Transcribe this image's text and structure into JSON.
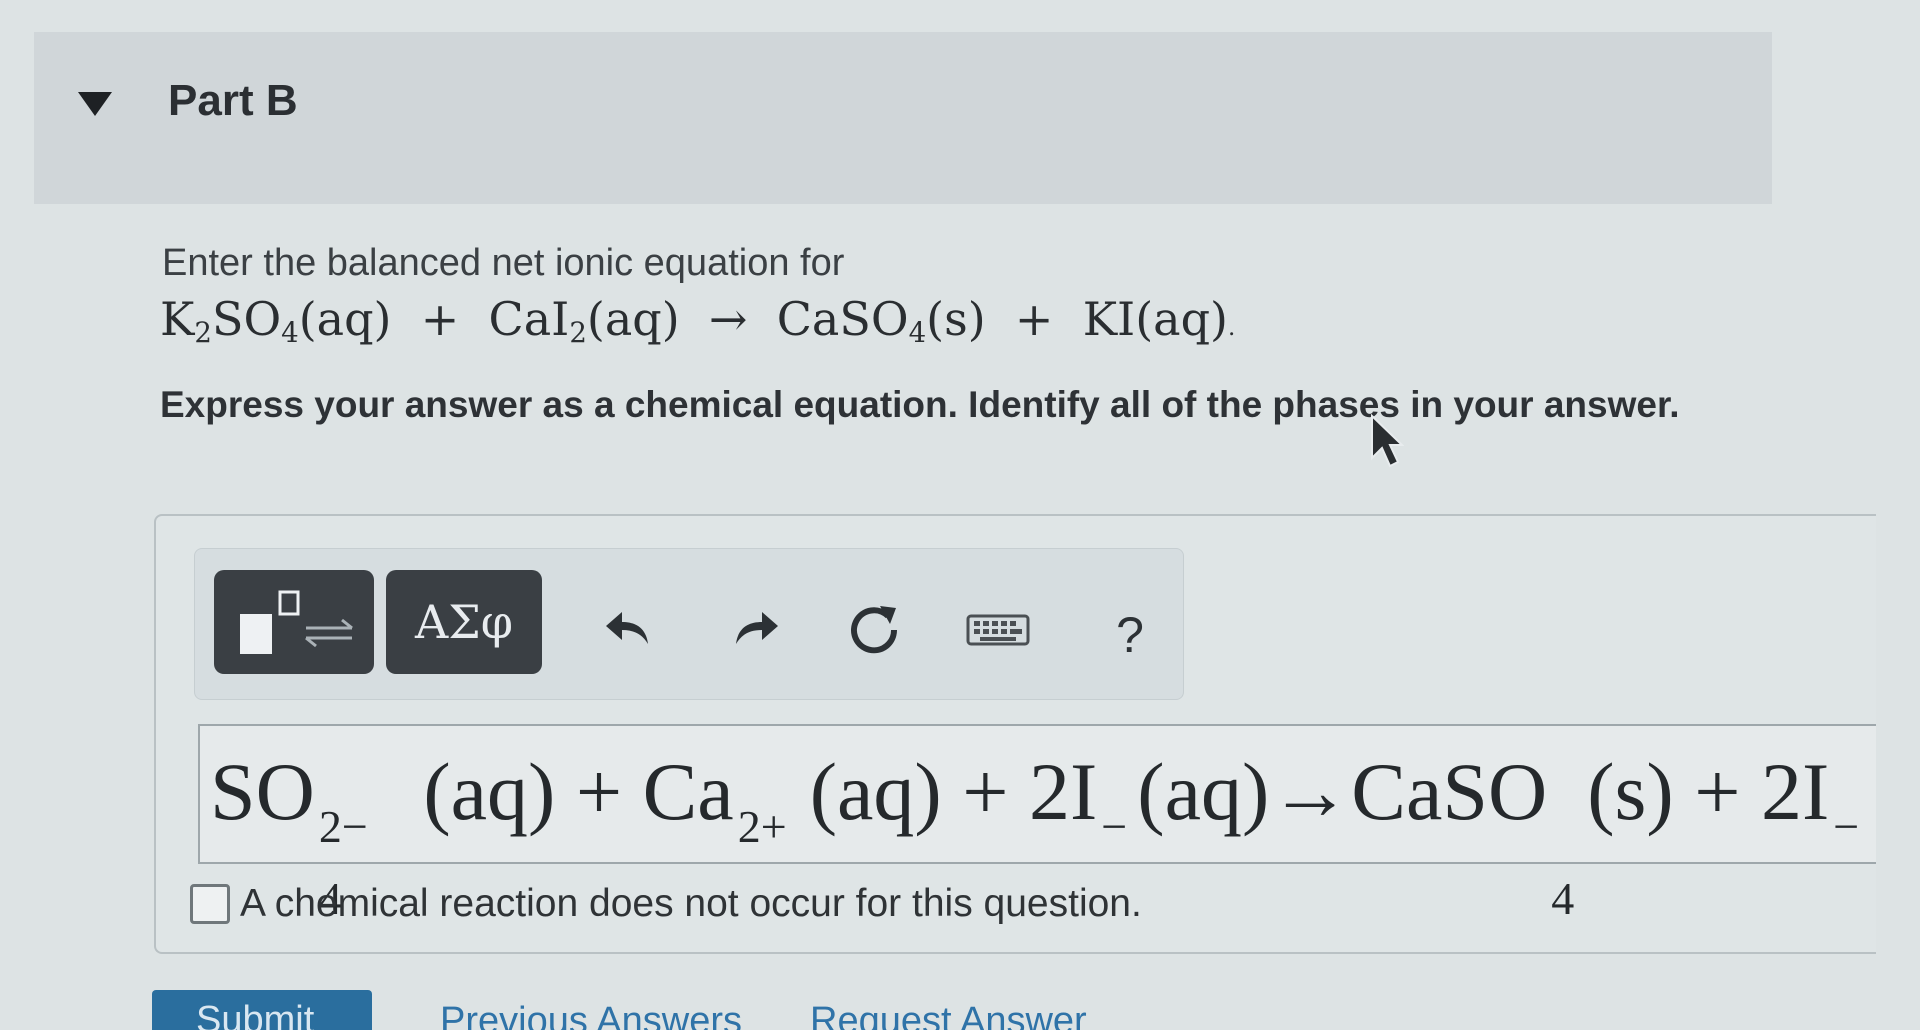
{
  "part": {
    "title": "Part B"
  },
  "question": {
    "prompt": "Enter the balanced net ionic equation for",
    "equation": {
      "r1": "K",
      "r1_sub": "2",
      "r1_mid": "SO",
      "r1_sub2": "4",
      "r1_phase": "(aq)",
      "plus": "+",
      "r2": "CaI",
      "r2_sub": "2",
      "r2_phase": "(aq)",
      "arrow": "→",
      "p1": "CaSO",
      "p1_sub": "4",
      "p1_phase": "(s)",
      "p2": "KI(aq)",
      "end": "."
    },
    "instructions": "Express your answer as a chemical equation. Identify all of the phases in your answer."
  },
  "toolbar": {
    "symbols_label": "ΑΣφ",
    "help_label": "?",
    "icons": [
      "templates-icon",
      "undo-icon",
      "redo-icon",
      "reset-icon",
      "keyboard-icon",
      "help-icon"
    ]
  },
  "answer": {
    "t1": "SO",
    "t1_sub": "4",
    "t1_sup": "2−",
    "t1_phase": "(aq)",
    "plus1": "+",
    "t2": "Ca",
    "t2_sup": "2+",
    "t2_phase": "(aq)",
    "plus2": "+",
    "t3": "2I",
    "t3_sup": "−",
    "t3_phase": "(aq)",
    "arrow": "→",
    "t4": "CaSO",
    "t4_sub": "4",
    "t4_phase": "(s)",
    "plus3": "+",
    "t5": "2I",
    "t5_sup": "−"
  },
  "no_reaction": {
    "label": "A chemical reaction does not occur for this question."
  },
  "actions": {
    "submit_label": "Submit",
    "previous_label": "Previous Answers",
    "request_label": "Request Answer"
  },
  "colors": {
    "accent": "#2a6e9e",
    "link": "#2f73a8",
    "dark_button": "#3a3f44"
  }
}
